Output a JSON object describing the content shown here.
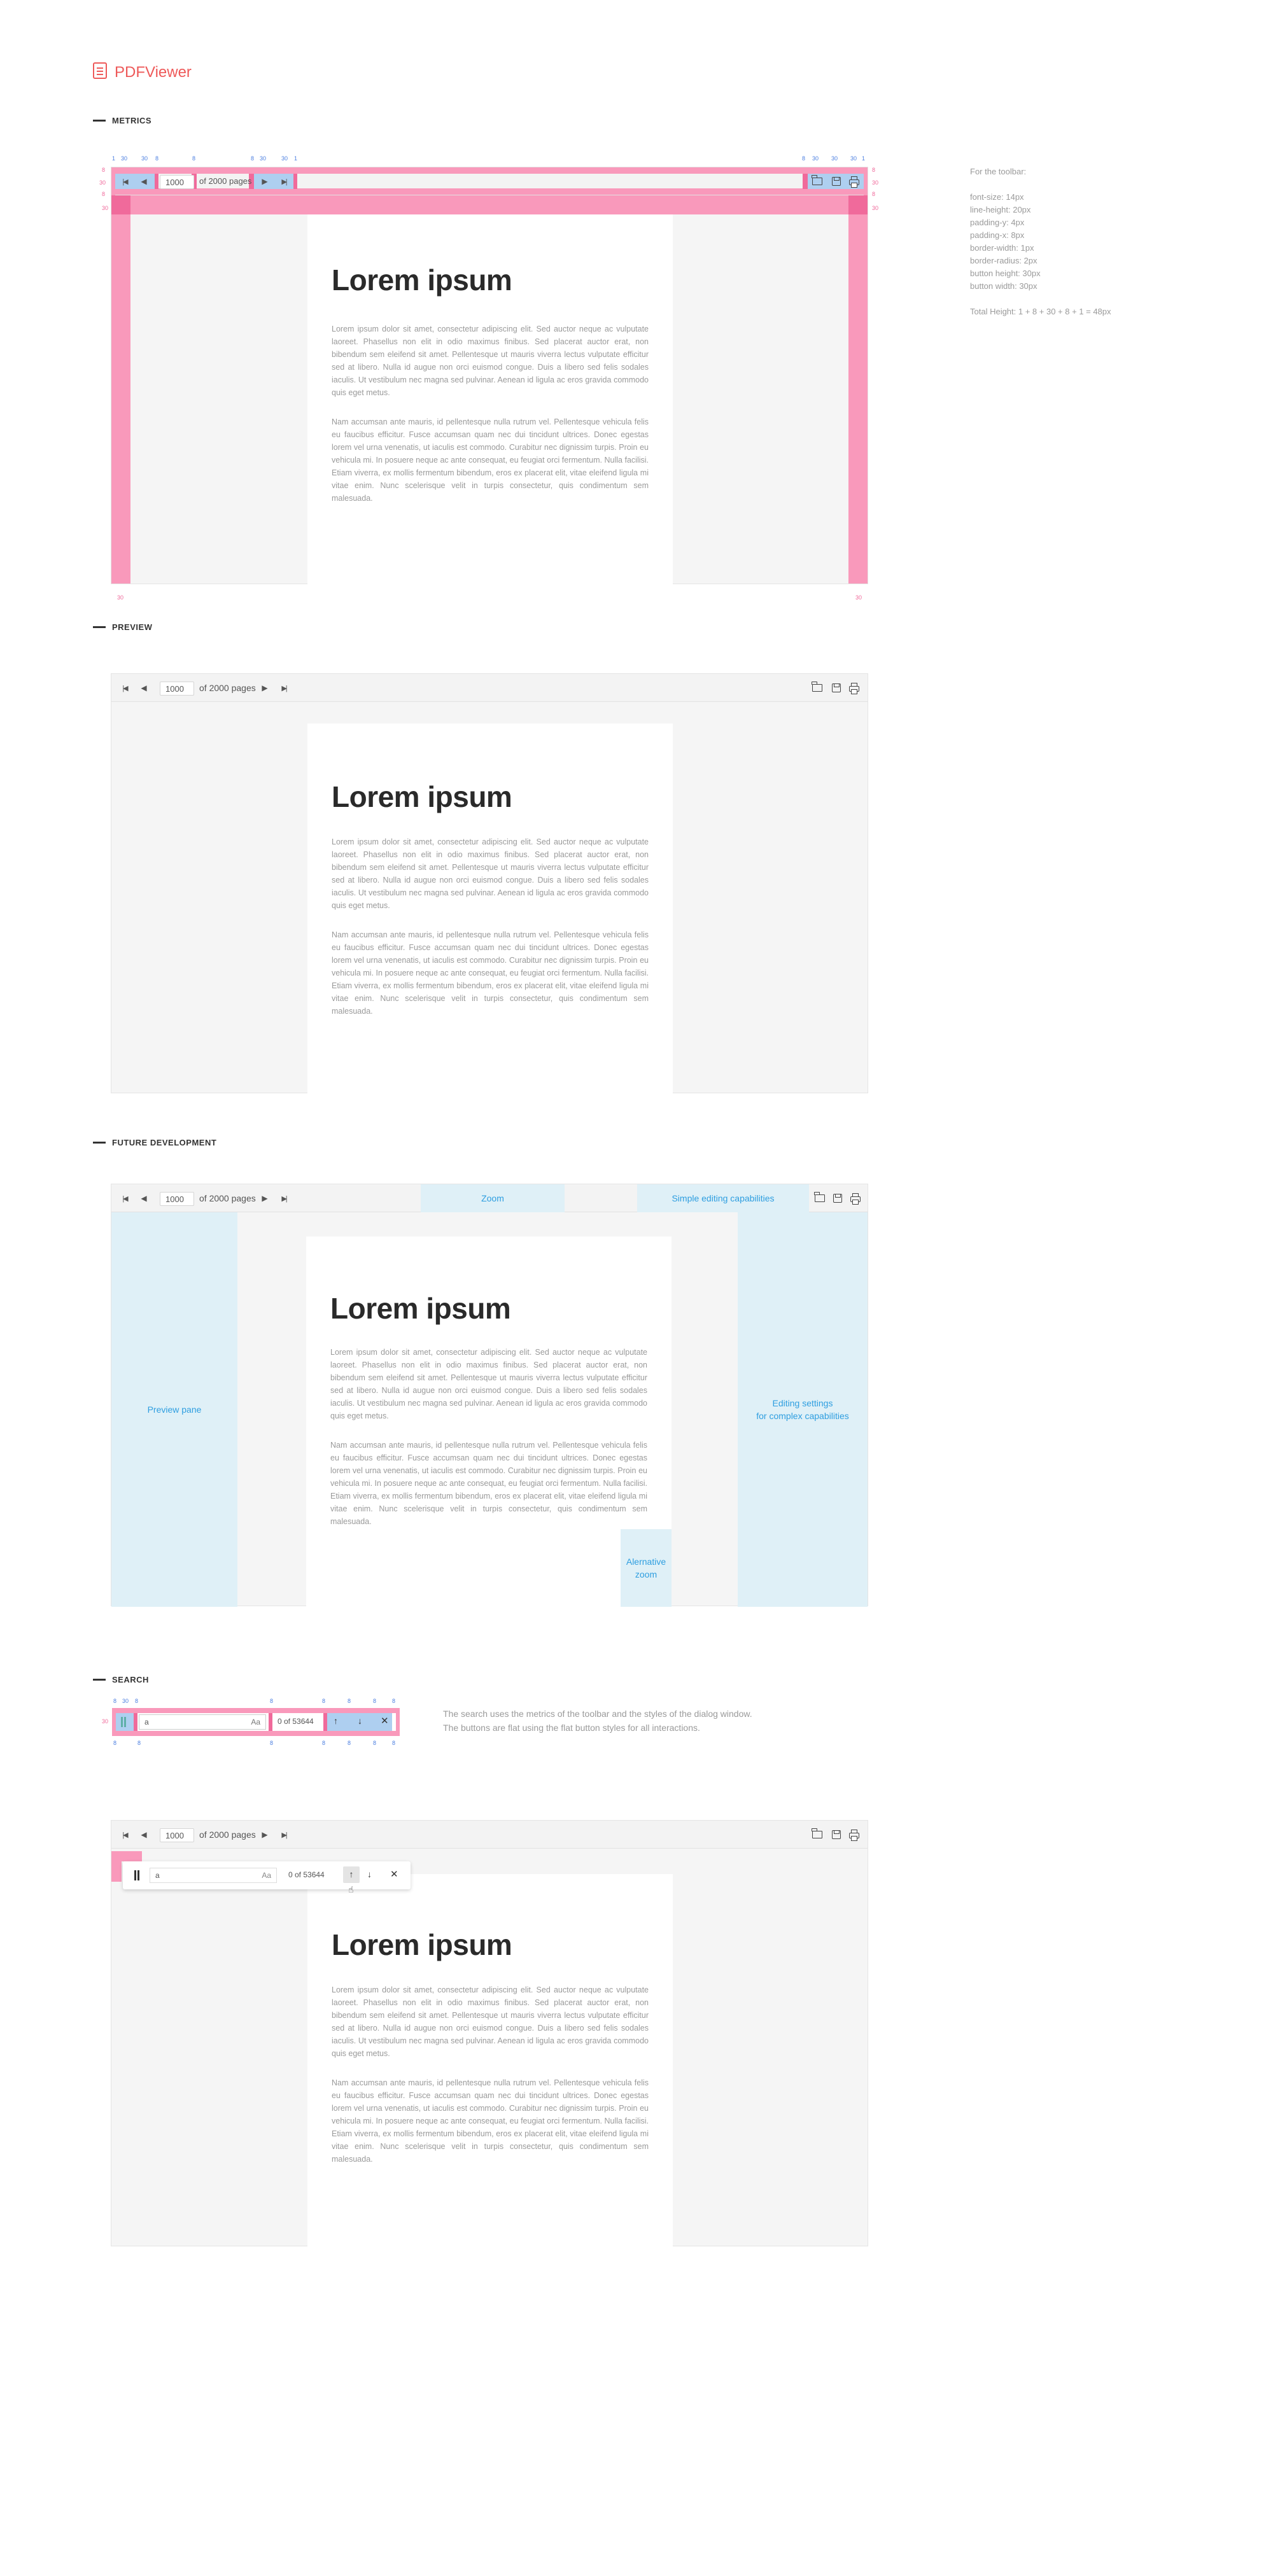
{
  "brand": {
    "name": "PDFViewer",
    "icon": "pdf-file-icon"
  },
  "sections": {
    "metrics": "METRICS",
    "preview": "PREVIEW",
    "future": "FUTURE DEVELOPMENT",
    "search": "SEARCH"
  },
  "toolbar": {
    "page_value": "1000",
    "page_of": "of 2000 pages",
    "icons": [
      "first-page-icon",
      "prev-page-icon",
      "next-page-icon",
      "last-page-icon",
      "folder-open-icon",
      "save-icon",
      "print-icon"
    ]
  },
  "document": {
    "title": "Lorem ipsum",
    "paragraph1": "Lorem ipsum dolor sit amet, consectetur adipiscing elit. Sed auctor neque ac vulputate laoreet. Phasellus non elit in odio maximus finibus. Sed placerat auctor erat, non bibendum sem eleifend sit amet. Pellentesque ut mauris viverra lectus vulputate efficitur sed at libero. Nulla id augue non orci euismod congue. Duis a libero sed felis sodales iaculis. Ut vestibulum nec magna sed pulvinar. Aenean id ligula ac eros gravida commodo quis eget metus.",
    "paragraph2": "Nam accumsan ante mauris, id pellentesque nulla rutrum vel. Pellentesque vehicula felis eu faucibus efficitur. Fusce accumsan quam nec dui tincidunt ultrices. Donec egestas lorem vel urna venenatis, ut iaculis est commodo. Curabitur nec dignissim turpis. Proin eu vehicula mi. In posuere neque ac ante consequat, eu feugiat orci fermentum. Nulla facilisi. Etiam viverra, ex mollis fermentum bibendum, eros ex placerat elit, vitae eleifend ligula mi vitae enim. Nunc scelerisque velit in turpis consectetur, quis condimentum sem malesuada."
  },
  "metrics": {
    "specs": [
      "For the toolbar:",
      "",
      "font-size: 14px",
      "line-height: 20px",
      "padding-y: 4px",
      "padding-x: 8px",
      "border-width: 1px",
      "border-radius: 2px",
      "button height: 30px",
      "button width: 30px",
      "",
      "Total Height: 1 + 8 + 30 + 8 + 1 = 48px"
    ],
    "labels": {
      "m1": "1",
      "m30": "30",
      "m8": "8",
      "m4": "4",
      "m2": "2"
    }
  },
  "future": {
    "zoom": "Zoom",
    "editing": "Simple editing capabilities",
    "preview_pane": "Preview pane",
    "editing_settings_1": "Editing settings",
    "editing_settings_2": "for complex capabilities",
    "alt_zoom_1": "Alernative",
    "alt_zoom_2": "zoom"
  },
  "search": {
    "query": "a",
    "case_toggle": "Aa",
    "result_count": "0 of 53644",
    "description_line1": "The search uses the metrics of the toolbar and the styles of the dialog window.",
    "description_line2": "The buttons are flat using the flat button styles for all interactions."
  },
  "colors": {
    "brand": "#ee5a5a",
    "metric_pink": "#f999bb",
    "metric_blue": "#aecff0",
    "zone_fill": "#dff0f7",
    "zone_text": "#2e9ee0"
  }
}
